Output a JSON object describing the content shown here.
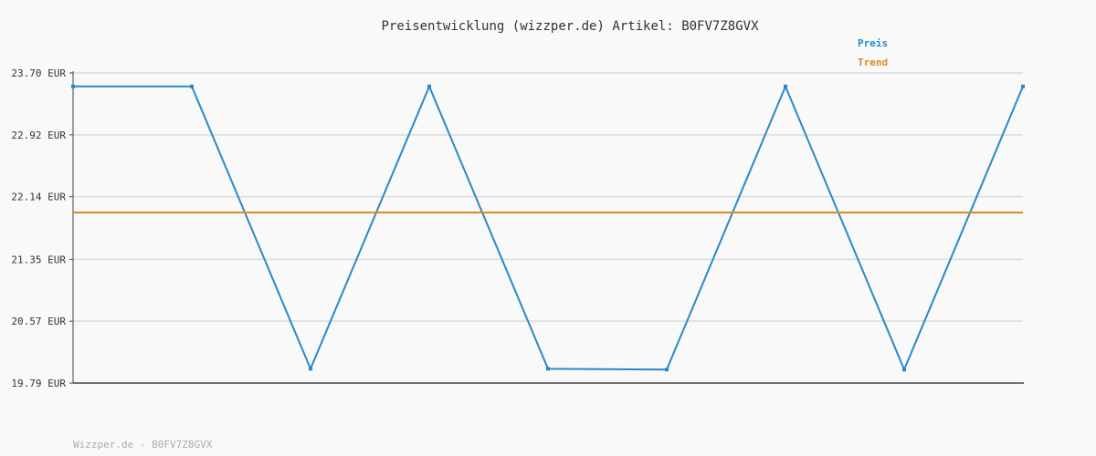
{
  "chart_data": {
    "type": "line",
    "title": "Preisentwicklung (wizzper.de) Artikel: B0FV7Z8GVX",
    "footer": "Wizzper.de - B0FV7Z8GVX",
    "ylim": [
      19.79,
      23.7
    ],
    "yticks": [
      "23.70 EUR",
      "22.92 EUR",
      "22.14 EUR",
      "21.35 EUR",
      "20.57 EUR",
      "19.79 EUR"
    ],
    "ytick_values": [
      23.7,
      22.92,
      22.14,
      21.35,
      20.57,
      19.79
    ],
    "grid": true,
    "legend_position": "top-right",
    "series": [
      {
        "name": "Preis",
        "color": "#2a88c8",
        "values": [
          23.53,
          23.53,
          19.97,
          23.53,
          19.97,
          19.96,
          23.53,
          19.96,
          23.53
        ]
      },
      {
        "name": "Trend",
        "color": "#d98a1f",
        "values": [
          21.94,
          21.94
        ]
      }
    ]
  }
}
